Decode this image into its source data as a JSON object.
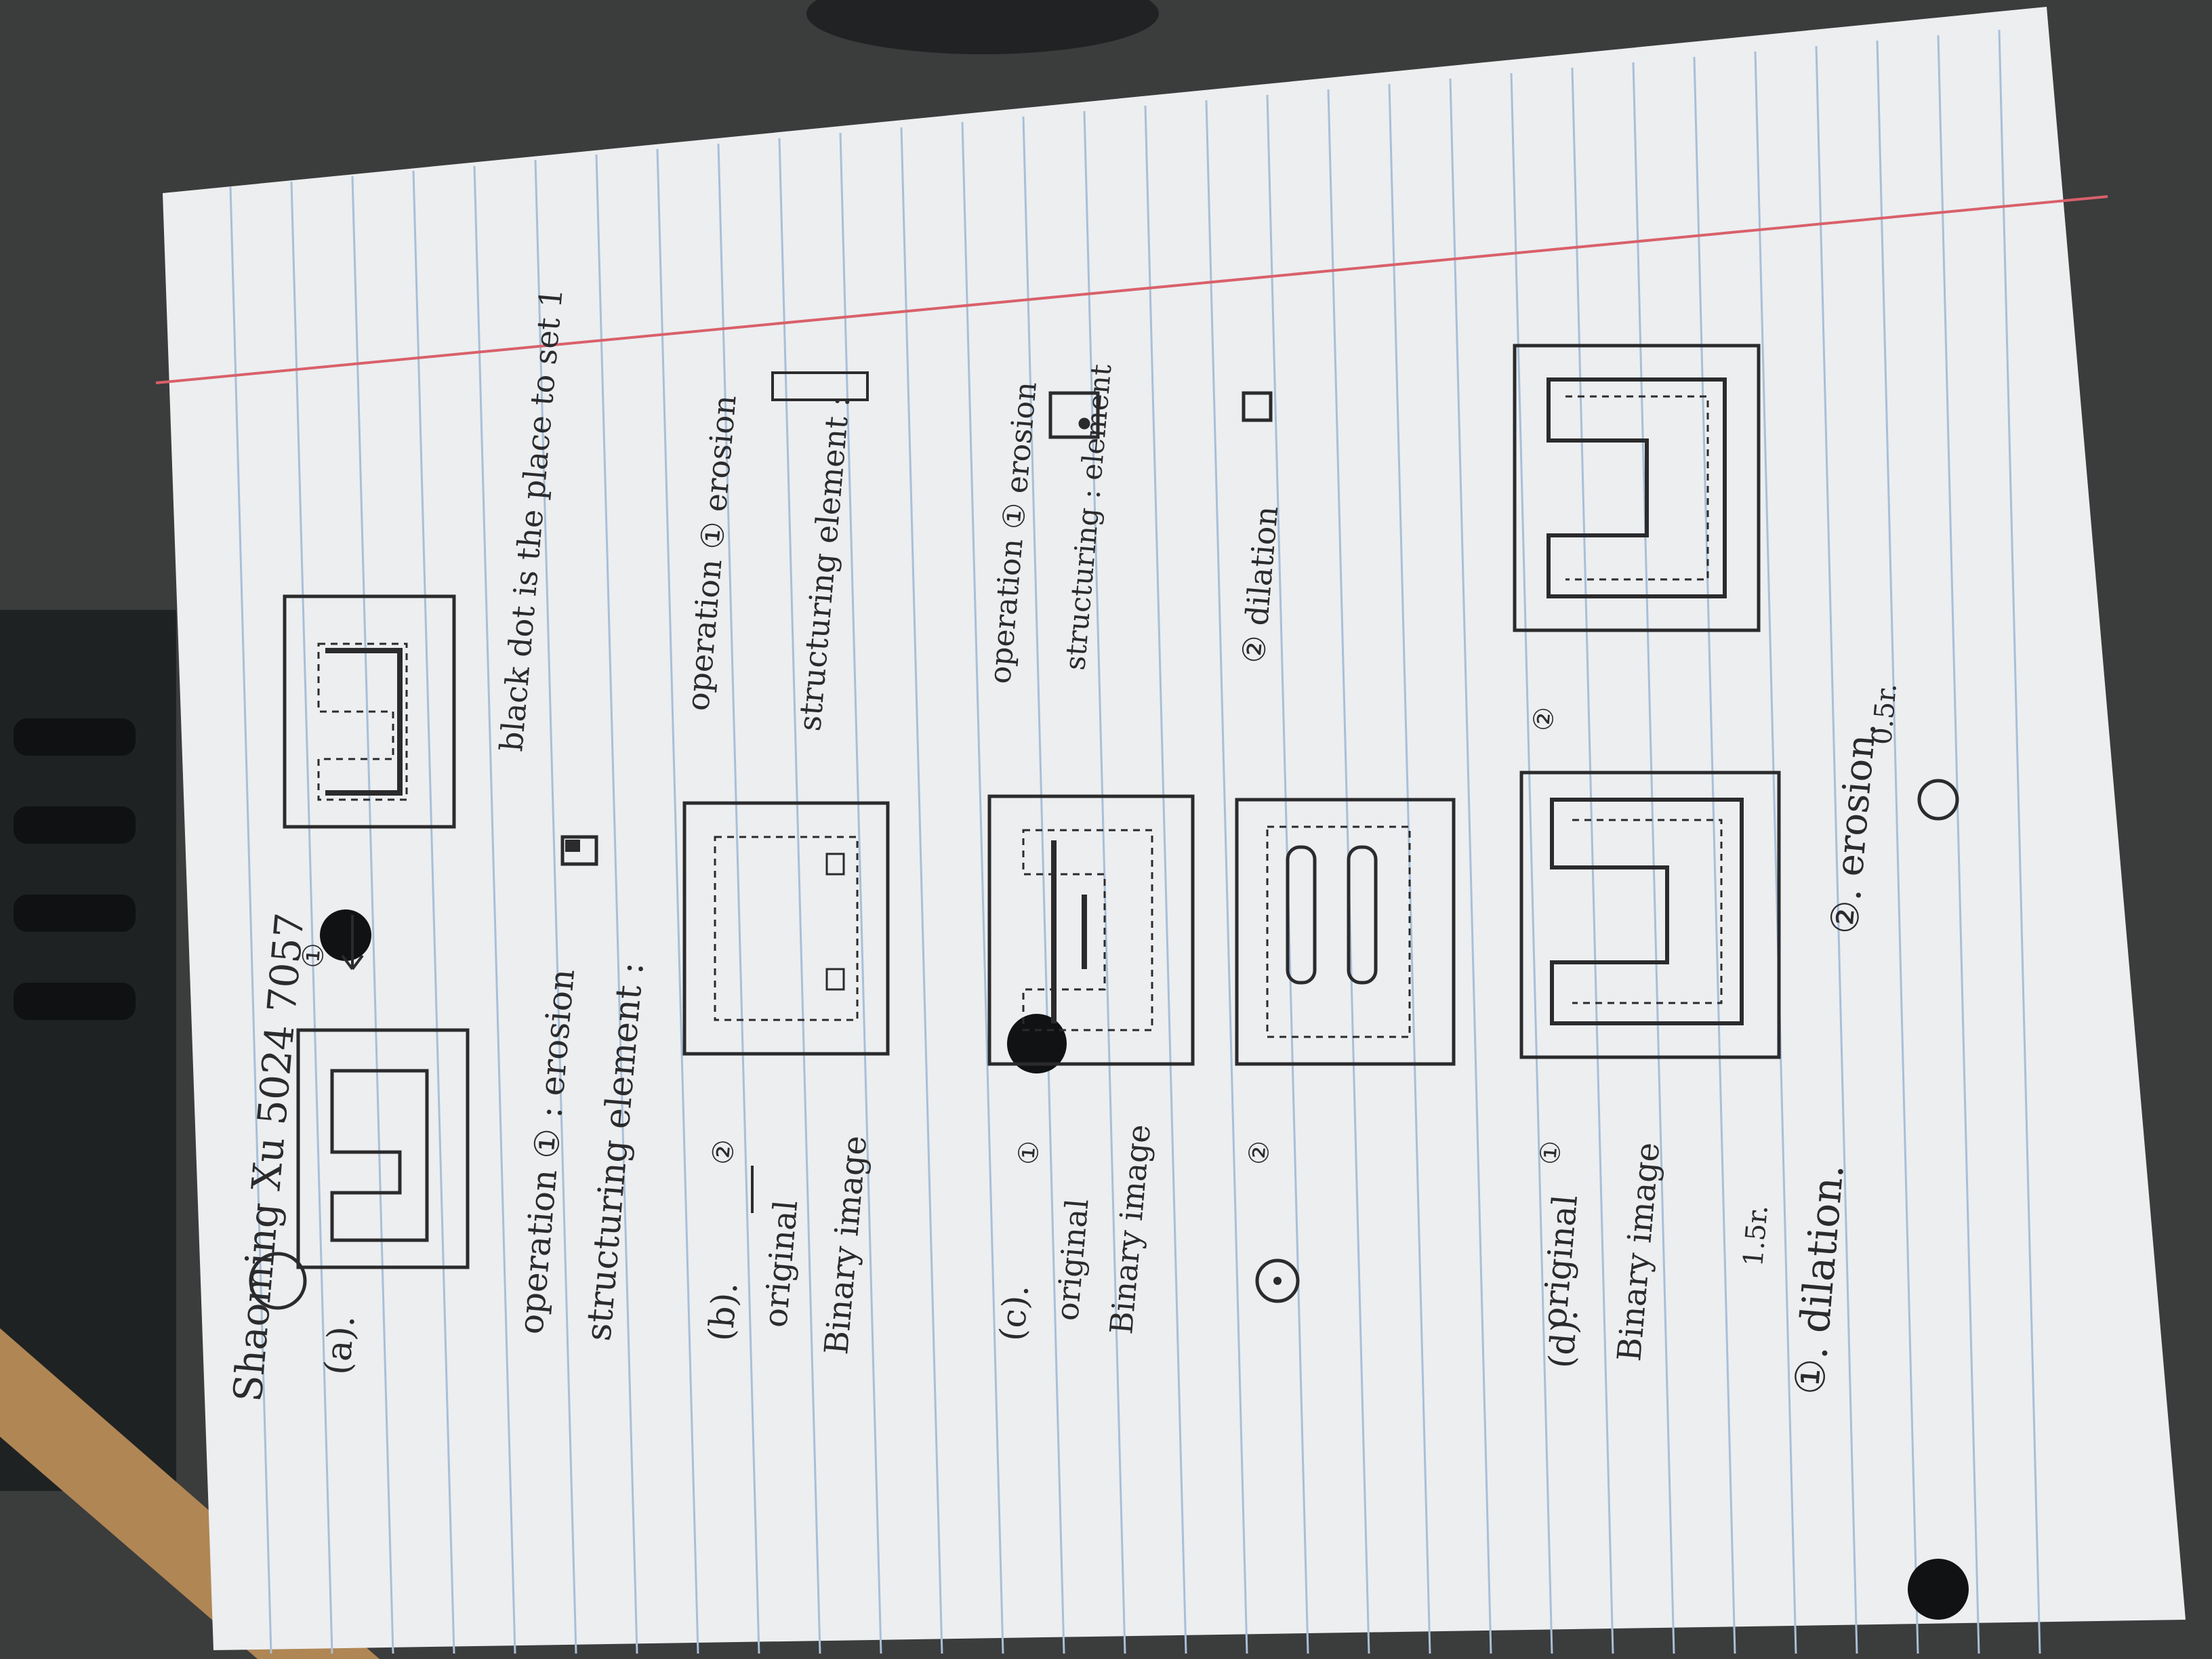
{
  "colors": {
    "background": "#3a3b3b",
    "paper": "#eceef0",
    "rule_line": "#a9bfd6",
    "margin_line": "#d9606a",
    "ink": "#2b2b2d",
    "wood": "#b08654"
  },
  "header": {
    "name_id": "Shaoming Xu  5024 7057"
  },
  "part_a": {
    "label": "(a).",
    "step_marker": "①",
    "operation": "operation ① : erosion",
    "structuring_element": "structuring element :",
    "note": "black dot is the place to set 1"
  },
  "part_b": {
    "label": "(b).",
    "original": "original",
    "binary_image": "Binary image",
    "step_marker": "②",
    "operation": "operation ① erosion",
    "structuring_element": "structuring element :"
  },
  "part_c": {
    "label": "(c).",
    "original": "original",
    "binary_image": "Binary image",
    "step_marker_1": "①",
    "step_marker_2": "②",
    "operation": "operation ① erosion",
    "structuring_element": "structuring : element",
    "dilation": "② dilation"
  },
  "part_d": {
    "label": "(d).",
    "original": "original",
    "binary_image": "Binary image",
    "step_marker_1": "①",
    "step_marker_2": "②",
    "dilation": "①. dilation.",
    "dilation_radius": "1.5r.",
    "erosion": "②. erosion.",
    "erosion_radius": "0.5r."
  },
  "icons": [
    "hole-punch-icon",
    "structuring-element-icon",
    "disk-element-icon"
  ]
}
